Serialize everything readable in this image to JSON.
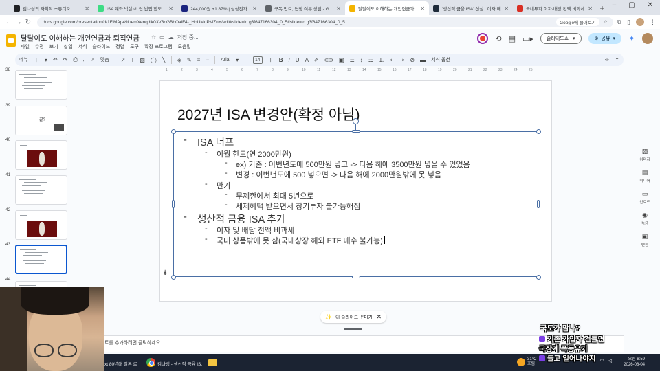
{
  "browser": {
    "tabs": [
      {
        "label": "김나성의 자치적 스튜디오",
        "color": "#202124",
        "active": false
      },
      {
        "label": "ISA 계좌 박살~!! 연 납입 한도",
        "color": "#3ddc84",
        "active": false
      },
      {
        "label": "244,000원 +1.87% | 삼성전자",
        "color": "#1a237e",
        "active": false
      },
      {
        "label": "구독 만료, 연장 여부 상담 - G",
        "color": "#5f6368",
        "active": false
      },
      {
        "label": "탈탈이도 이해하는 개인연금과",
        "color": "#f4b400",
        "active": true
      },
      {
        "label": "'생산적 금융 ISA' 신설...이자·배",
        "color": "#1f2b3a",
        "active": false
      },
      {
        "label": "국내투자 이자·배당 전액 비과세",
        "color": "#d93025",
        "active": false
      }
    ],
    "url": "docs.google.com/presentation/d/1FlMAp49luemXenqdlk03V3nGBbOaiF4-_HoUMdPMZnY/edit#slide=id.g3f647166304_0_5#slide=id.g3f647166304_0_5",
    "search_chip": "Google에 물어보기"
  },
  "doc": {
    "title": "탈탈이도 이해하는 개인연금과 퇴직연금",
    "saved_label": "저장 중...",
    "menu": [
      "파일",
      "수정",
      "보기",
      "삽입",
      "서식",
      "슬라이드",
      "정렬",
      "도구",
      "확장 프로그램",
      "도움말"
    ],
    "slideshow_label": "슬라이드쇼",
    "share_label": "공유"
  },
  "toolbar": {
    "menu_search": "메뉴",
    "zoom": "맞춤",
    "font": "Arial",
    "font_size": "14",
    "format_options": "서식 옵션"
  },
  "ruler": [
    "1",
    "2",
    "3",
    "4",
    "5",
    "6",
    "7",
    "8",
    "9",
    "10",
    "11",
    "12",
    "13",
    "14",
    "15",
    "16",
    "17",
    "18",
    "19",
    "20",
    "21",
    "22",
    "23",
    "24",
    "25"
  ],
  "filmstrip": [
    {
      "num": "38",
      "kind": "text"
    },
    {
      "num": "39",
      "kind": "question",
      "label": "끝?"
    },
    {
      "num": "40",
      "kind": "image"
    },
    {
      "num": "41",
      "kind": "text"
    },
    {
      "num": "42",
      "kind": "image"
    },
    {
      "num": "43",
      "kind": "text",
      "selected": true
    },
    {
      "num": "44",
      "kind": "text"
    }
  ],
  "slide": {
    "title": "2027년 ISA 변경안(확정 아님)",
    "bullets": [
      {
        "level": 1,
        "text": "ISA 너프"
      },
      {
        "level": 2,
        "text": "이월 한도(연 2000만원)"
      },
      {
        "level": 3,
        "text": "ex) 기존 : 이번년도에 500만원 넣고 -> 다음 해에 3500만원 넣을 수 있었음"
      },
      {
        "level": 3,
        "text": "변경 : 이번년도에 500 넣으면 -> 다음 해에 2000만원밖에 못 넣음"
      },
      {
        "level": 2,
        "text": "만기"
      },
      {
        "level": 3,
        "text": "무제한에서 최대 5년으로"
      },
      {
        "level": 3,
        "text": "세제혜택 받으면서 장기투자 불가능해짐"
      },
      {
        "level": 1,
        "text": "생산적 금융 ISA 추가"
      },
      {
        "level": 2,
        "text": "이자 및 배당 전액 비과세"
      },
      {
        "level": 2,
        "text": "국내 상품밖에 못 삼(국내상장 해외 ETF 매수 불가능)"
      }
    ],
    "bullet_marker": "-"
  },
  "deco_pill": "이 슬라이드 꾸미기",
  "notes_placeholder": "트를 추가하려면 클릭하세요.",
  "side_panel": [
    {
      "icon": "image-icon",
      "label": "이미지"
    },
    {
      "icon": "media-icon",
      "label": "미디어"
    },
    {
      "icon": "folder-icon",
      "label": "업로드"
    },
    {
      "icon": "record-icon",
      "label": "녹음"
    },
    {
      "icon": "video-icon",
      "label": "변환"
    }
  ],
  "taskbar": {
    "left_text": "xt 80년대 일본 로",
    "chrome_text": "김나성 - 생산적 금융 IS.",
    "weather_temp": "31°C",
    "weather_desc": "흐림",
    "time": "오전 8:59",
    "date": "2026-08-04"
  },
  "chat": [
    "국도가 맘나?",
    "기존 가입자 건들면",
    "국장계 폭동유기",
    "들고 일어나야지"
  ]
}
